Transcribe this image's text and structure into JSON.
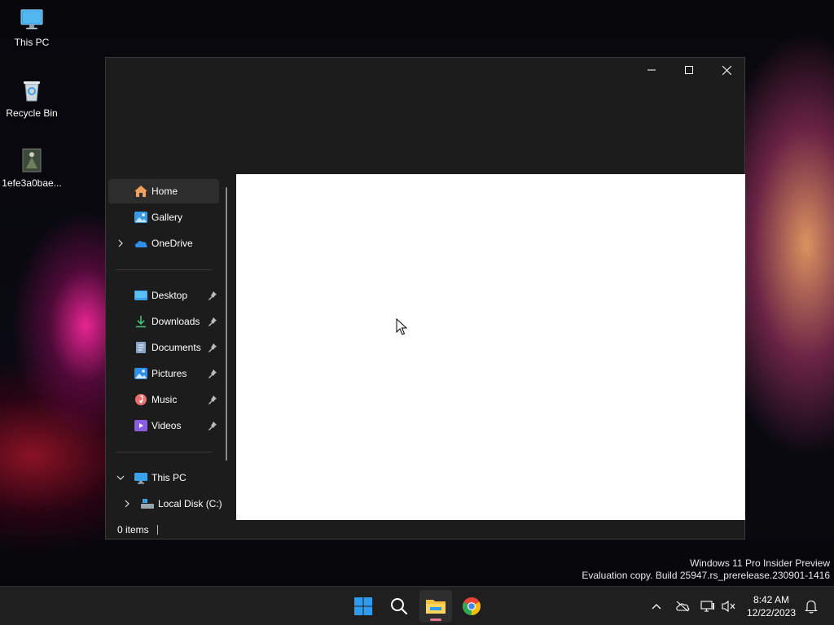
{
  "desktop": {
    "icons": [
      {
        "label": "This PC",
        "icon": "monitor-icon"
      },
      {
        "label": "Recycle Bin",
        "icon": "recycle-bin-icon"
      },
      {
        "label": "1efe3a0bae...",
        "icon": "image-file-icon"
      }
    ]
  },
  "window": {
    "controls": {
      "minimize": "minimize-icon",
      "maximize": "maximize-icon",
      "close": "close-icon"
    },
    "nav": {
      "top": [
        {
          "label": "Home",
          "icon": "home-icon",
          "active": true
        },
        {
          "label": "Gallery",
          "icon": "gallery-icon"
        },
        {
          "label": "OneDrive",
          "icon": "cloud-icon",
          "expandable": true
        }
      ],
      "quick_access": [
        {
          "label": "Desktop",
          "icon": "desktop-folder-icon",
          "pinned": true
        },
        {
          "label": "Downloads",
          "icon": "download-icon",
          "pinned": true
        },
        {
          "label": "Documents",
          "icon": "documents-icon",
          "pinned": true
        },
        {
          "label": "Pictures",
          "icon": "pictures-icon",
          "pinned": true
        },
        {
          "label": "Music",
          "icon": "music-icon",
          "pinned": true
        },
        {
          "label": "Videos",
          "icon": "videos-icon",
          "pinned": true
        }
      ],
      "this_pc": {
        "label": "This PC",
        "icon": "monitor-icon",
        "expanded": true
      },
      "local_disk": {
        "label": "Local Disk (C:)",
        "icon": "drive-icon"
      }
    },
    "status": {
      "items": "0 items"
    }
  },
  "watermark": {
    "line1": "Windows 11 Pro Insider Preview",
    "line2": "Evaluation copy. Build 25947.rs_prerelease.230901-1416"
  },
  "taskbar": {
    "apps": [
      "start-icon",
      "search-icon",
      "file-explorer-icon",
      "chrome-icon"
    ],
    "tray": [
      "chevron-up-icon",
      "onedrive-offline-icon",
      "network-icon",
      "volume-muted-icon",
      "notification-bell-icon"
    ],
    "time": "8:42 AM",
    "date": "12/22/2023"
  },
  "colors": {
    "accent": "#0078d4",
    "window_bg": "#1c1c1c",
    "content_bg": "#ffffff",
    "taskbar_bg": "#1f1f1f"
  }
}
